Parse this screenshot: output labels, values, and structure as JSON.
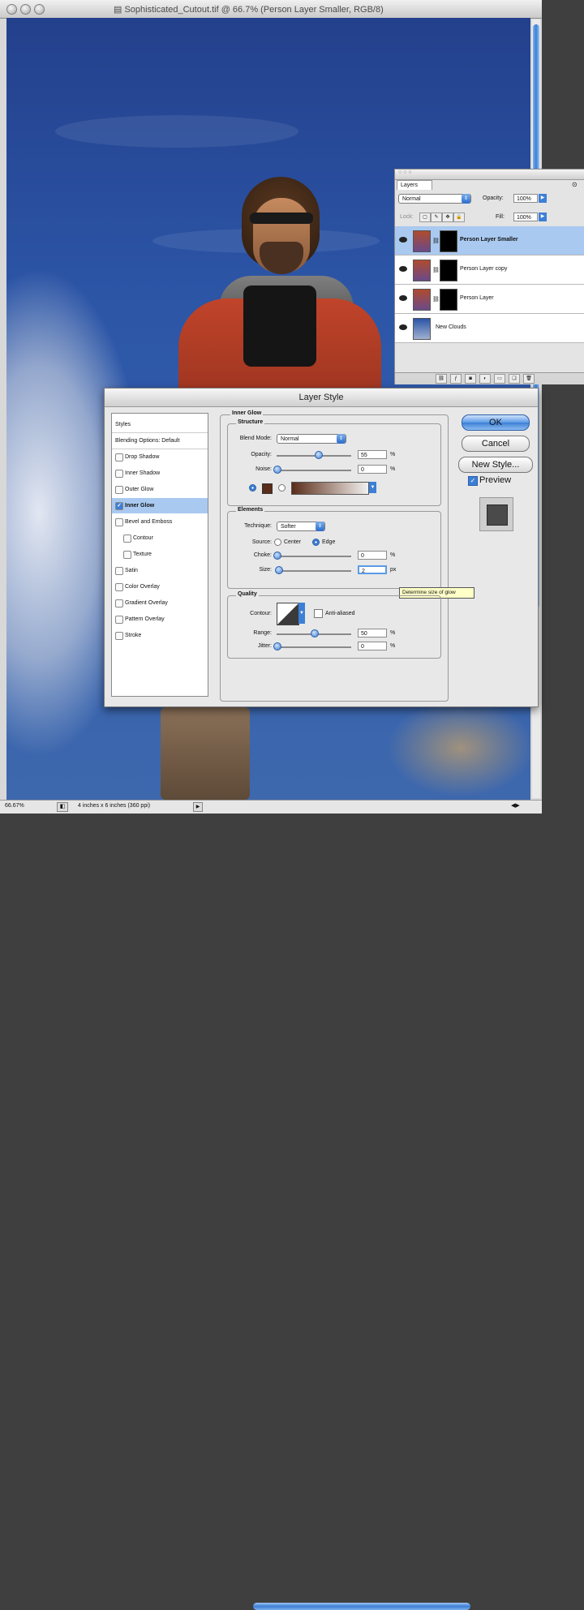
{
  "window": {
    "title": "Sophisticated_Cutout.tif @ 66.7% (Person Layer Smaller, RGB/8)"
  },
  "status_bar": {
    "zoom": "66.67%",
    "doc_info": "4 inches x 6 inches (360 ppi)"
  },
  "layers_panel": {
    "tab": "Layers",
    "blend_mode": "Normal",
    "opacity_label": "Opacity:",
    "opacity_value": "100%",
    "lock_label": "Lock:",
    "fill_label": "Fill:",
    "fill_value": "100%",
    "layers": [
      {
        "name": "Person Layer Smaller",
        "selected": true
      },
      {
        "name": "Person Layer copy",
        "selected": false
      },
      {
        "name": "Person Layer",
        "selected": false
      },
      {
        "name": "New Clouds",
        "selected": false
      }
    ]
  },
  "layer_style": {
    "title": "Layer Style",
    "styles_list": [
      {
        "label": "Styles",
        "type": "header"
      },
      {
        "label": "Blending Options: Default",
        "type": "header"
      },
      {
        "label": "Drop Shadow",
        "checked": false
      },
      {
        "label": "Inner Shadow",
        "checked": false
      },
      {
        "label": "Outer Glow",
        "checked": false
      },
      {
        "label": "Inner Glow",
        "checked": true,
        "active": true
      },
      {
        "label": "Bevel and Emboss",
        "checked": false
      },
      {
        "label": "Contour",
        "checked": false,
        "indent": true
      },
      {
        "label": "Texture",
        "checked": false,
        "indent": true
      },
      {
        "label": "Satin",
        "checked": false
      },
      {
        "label": "Color Overlay",
        "checked": false
      },
      {
        "label": "Gradient Overlay",
        "checked": false
      },
      {
        "label": "Pattern Overlay",
        "checked": false
      },
      {
        "label": "Stroke",
        "checked": false
      }
    ],
    "section_title": "Inner Glow",
    "structure": {
      "title": "Structure",
      "blend_mode_label": "Blend Mode:",
      "blend_mode": "Normal",
      "opacity_label": "Opacity:",
      "opacity": "55",
      "opacity_fraction": 0.55,
      "noise_label": "Noise:",
      "noise": "0",
      "noise_fraction": 0.0,
      "unit_percent": "%",
      "glow_color": "#5a2c1a"
    },
    "elements": {
      "title": "Elements",
      "technique_label": "Technique:",
      "technique": "Softer",
      "source_label": "Source:",
      "source_center": "Center",
      "source_edge": "Edge",
      "choke_label": "Choke:",
      "choke": "0",
      "choke_fraction": 0.0,
      "size_label": "Size:",
      "size": "2",
      "size_fraction": 0.02,
      "unit_px": "px",
      "tooltip": "Determine size of glow"
    },
    "quality": {
      "title": "Quality",
      "contour_label": "Contour:",
      "anti_aliased": "Anti-aliased",
      "range_label": "Range:",
      "range": "50",
      "range_fraction": 0.5,
      "jitter_label": "Jitter:",
      "jitter": "0",
      "jitter_fraction": 0.0
    },
    "buttons": {
      "ok": "OK",
      "cancel": "Cancel",
      "new_style": "New Style...",
      "preview": "Preview"
    }
  }
}
